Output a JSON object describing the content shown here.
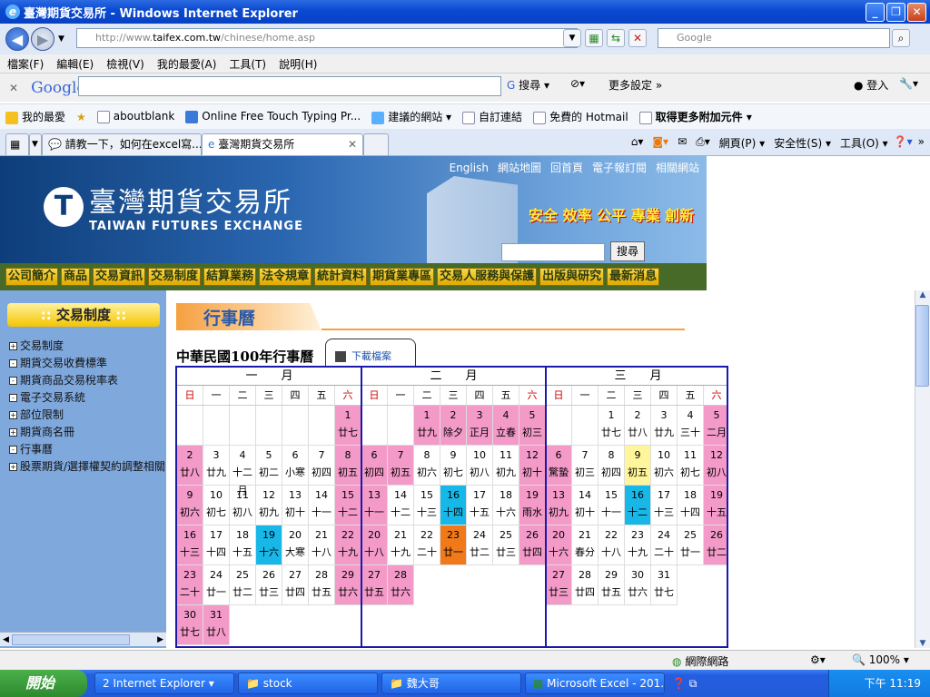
{
  "window": {
    "title": "臺灣期貨交易所 - Windows Internet Explorer"
  },
  "address": {
    "url_prefix": "http://www.",
    "url_domain": "taifex.com.tw",
    "url_suffix": "/chinese/home.asp",
    "search_placeholder": "Google"
  },
  "menu": [
    "檔案(F)",
    "編輯(E)",
    "檢視(V)",
    "我的最愛(A)",
    "工具(T)",
    "說明(H)"
  ],
  "google_toolbar": {
    "logo": "Google",
    "search_label": "搜尋",
    "more_settings": "更多設定 »",
    "login": "登入"
  },
  "favorites": {
    "label": "我的最愛",
    "items": [
      "aboutblank",
      "Online Free Touch Typing Pr...",
      "建議的網站",
      "自訂連結",
      "免費的 Hotmail",
      "取得更多附加元件"
    ]
  },
  "tabs": [
    "請教一下，如何在excel寫...",
    "臺灣期貨交易所"
  ],
  "ie_commands": {
    "page": "網頁(P)",
    "safety": "安全性(S)",
    "tools": "工具(O)"
  },
  "site": {
    "top_links": [
      "English",
      "網站地圖",
      "回首頁",
      "電子報訂閱",
      "相關網站"
    ],
    "logo_zh": "臺灣期貨交易所",
    "logo_en": "TAIWAN FUTURES EXCHANGE",
    "slogan": "安全 效率 公平 專業 創新",
    "search_button": "搜尋",
    "nav": [
      "公司簡介",
      "商品",
      "交易資訊",
      "交易制度",
      "結算業務",
      "法令規章",
      "統計資料",
      "期貨業專區",
      "交易人服務與保護",
      "出版與研究",
      "最新消息"
    ],
    "sidebar_title": "交易制度",
    "sidebar_items": [
      {
        "box": "+",
        "label": "交易制度"
      },
      {
        "box": "-",
        "label": "期貨交易收費標準"
      },
      {
        "box": "-",
        "label": "期貨商品交易稅率表"
      },
      {
        "box": "-",
        "label": "電子交易系統"
      },
      {
        "box": "+",
        "label": "部位限制"
      },
      {
        "box": "+",
        "label": "期貨商名冊"
      },
      {
        "box": "-",
        "label": "行事曆"
      },
      {
        "box": "+",
        "label": "股票期貨/選擇權契約調整相關"
      }
    ],
    "section_title": "行事曆",
    "calendar_title": "中華民國100年行事曆",
    "download_label": "下載檔案"
  },
  "calendar": {
    "weekdays": [
      "日",
      "一",
      "二",
      "三",
      "四",
      "五",
      "六"
    ],
    "months": [
      {
        "name": "一　　月",
        "cells": [
          [
            "",
            "",
            ""
          ],
          [
            "",
            "",
            ""
          ],
          [
            "",
            "",
            ""
          ],
          [
            "",
            "",
            ""
          ],
          [
            "",
            "",
            ""
          ],
          [
            "",
            "",
            ""
          ],
          [
            "1",
            "廿七",
            "pink"
          ],
          [
            "2",
            "廿八",
            "pink"
          ],
          [
            "3",
            "廿九",
            ""
          ],
          [
            "4",
            "十二月",
            ""
          ],
          [
            "5",
            "初二",
            ""
          ],
          [
            "6",
            "小寒",
            ""
          ],
          [
            "7",
            "初四",
            ""
          ],
          [
            "8",
            "初五",
            "pink"
          ],
          [
            "9",
            "初六",
            "pink"
          ],
          [
            "10",
            "初七",
            ""
          ],
          [
            "11",
            "初八",
            ""
          ],
          [
            "12",
            "初九",
            ""
          ],
          [
            "13",
            "初十",
            ""
          ],
          [
            "14",
            "十一",
            ""
          ],
          [
            "15",
            "十二",
            "pink"
          ],
          [
            "16",
            "十三",
            "pink"
          ],
          [
            "17",
            "十四",
            ""
          ],
          [
            "18",
            "十五",
            ""
          ],
          [
            "19",
            "十六",
            "cyan"
          ],
          [
            "20",
            "大寒",
            ""
          ],
          [
            "21",
            "十八",
            ""
          ],
          [
            "22",
            "十九",
            "pink"
          ],
          [
            "23",
            "二十",
            "pink"
          ],
          [
            "24",
            "廿一",
            ""
          ],
          [
            "25",
            "廿二",
            ""
          ],
          [
            "26",
            "廿三",
            ""
          ],
          [
            "27",
            "廿四",
            ""
          ],
          [
            "28",
            "廿五",
            ""
          ],
          [
            "29",
            "廿六",
            "pink"
          ],
          [
            "30",
            "廿七",
            "pink"
          ],
          [
            "31",
            "廿八",
            "pink"
          ]
        ]
      },
      {
        "name": "二　　月",
        "cells": [
          [
            "",
            "",
            ""
          ],
          [
            "",
            "",
            ""
          ],
          [
            "1",
            "廿九",
            "pink"
          ],
          [
            "2",
            "除夕",
            "pink"
          ],
          [
            "3",
            "正月",
            "pink"
          ],
          [
            "4",
            "立春",
            "pink"
          ],
          [
            "5",
            "初三",
            "pink"
          ],
          [
            "6",
            "初四",
            "pink"
          ],
          [
            "7",
            "初五",
            "pink"
          ],
          [
            "8",
            "初六",
            ""
          ],
          [
            "9",
            "初七",
            ""
          ],
          [
            "10",
            "初八",
            ""
          ],
          [
            "11",
            "初九",
            ""
          ],
          [
            "12",
            "初十",
            "pink"
          ],
          [
            "13",
            "十一",
            "pink"
          ],
          [
            "14",
            "十二",
            ""
          ],
          [
            "15",
            "十三",
            ""
          ],
          [
            "16",
            "十四",
            "cyan"
          ],
          [
            "17",
            "十五",
            ""
          ],
          [
            "18",
            "十六",
            ""
          ],
          [
            "19",
            "雨水",
            "pink"
          ],
          [
            "20",
            "十八",
            "pink"
          ],
          [
            "21",
            "十九",
            ""
          ],
          [
            "22",
            "二十",
            ""
          ],
          [
            "23",
            "廿一",
            "orange"
          ],
          [
            "24",
            "廿二",
            ""
          ],
          [
            "25",
            "廿三",
            ""
          ],
          [
            "26",
            "廿四",
            "pink"
          ],
          [
            "27",
            "廿五",
            "pink"
          ],
          [
            "28",
            "廿六",
            "pink"
          ]
        ]
      },
      {
        "name": "三　　月",
        "cells": [
          [
            "",
            "",
            ""
          ],
          [
            "",
            "",
            ""
          ],
          [
            "1",
            "廿七",
            ""
          ],
          [
            "2",
            "廿八",
            ""
          ],
          [
            "3",
            "廿九",
            ""
          ],
          [
            "4",
            "三十",
            ""
          ],
          [
            "5",
            "二月",
            "pink"
          ],
          [
            "6",
            "驚蟄",
            "pink"
          ],
          [
            "7",
            "初三",
            ""
          ],
          [
            "8",
            "初四",
            ""
          ],
          [
            "9",
            "初五",
            "yellow"
          ],
          [
            "10",
            "初六",
            ""
          ],
          [
            "11",
            "初七",
            ""
          ],
          [
            "12",
            "初八",
            "pink"
          ],
          [
            "13",
            "初九",
            "pink"
          ],
          [
            "14",
            "初十",
            ""
          ],
          [
            "15",
            "十一",
            ""
          ],
          [
            "16",
            "十二",
            "cyan"
          ],
          [
            "17",
            "十三",
            ""
          ],
          [
            "18",
            "十四",
            ""
          ],
          [
            "19",
            "十五",
            "pink"
          ],
          [
            "20",
            "十六",
            "pink"
          ],
          [
            "21",
            "春分",
            ""
          ],
          [
            "22",
            "十八",
            ""
          ],
          [
            "23",
            "十九",
            ""
          ],
          [
            "24",
            "二十",
            ""
          ],
          [
            "25",
            "廿一",
            ""
          ],
          [
            "26",
            "廿二",
            "pink"
          ],
          [
            "27",
            "廿三",
            "pink"
          ],
          [
            "28",
            "廿四",
            ""
          ],
          [
            "29",
            "廿五",
            ""
          ],
          [
            "30",
            "廿六",
            ""
          ],
          [
            "31",
            "廿七",
            ""
          ]
        ]
      }
    ]
  },
  "status": {
    "zone": "網際網路",
    "zoom": "100%"
  },
  "taskbar": {
    "start": "開始",
    "tasks": [
      "2 Internet Explorer",
      "stock",
      "魏大哥",
      "Microsoft Excel - 201..."
    ],
    "clock": "下午 11:19"
  }
}
